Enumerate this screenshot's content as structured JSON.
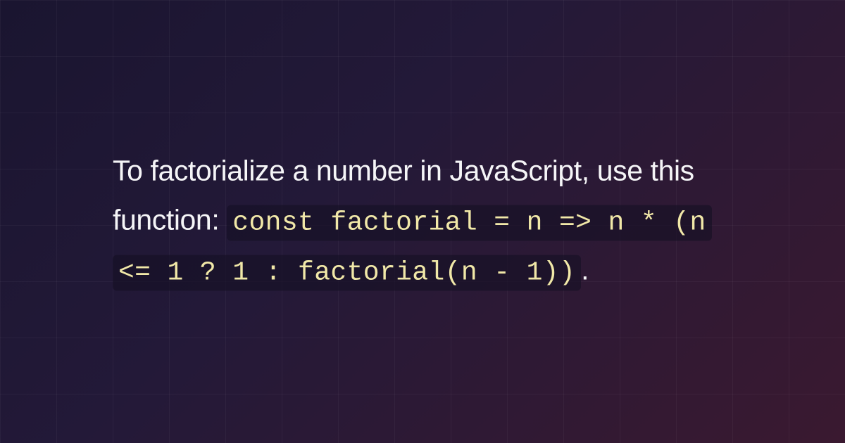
{
  "content": {
    "text_before": "To factorialize a number in JavaScript, use this function: ",
    "code": "const factorial = n => n * (n <= 1 ? 1 : factorial(n - 1))",
    "text_after": "."
  }
}
